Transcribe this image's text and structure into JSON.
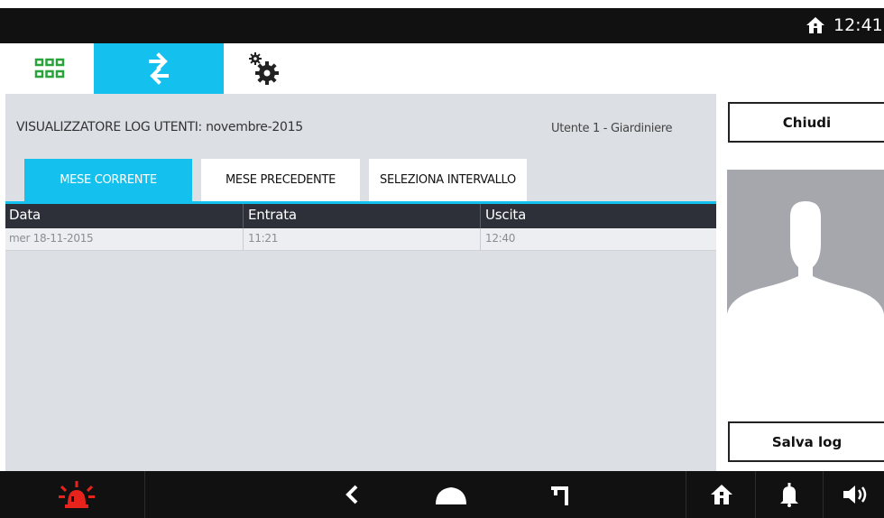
{
  "status": {
    "time": "12:41",
    "home_icon": "home-icon"
  },
  "app_tabs": [
    {
      "name": "apps-grid",
      "icon": "grid-icon",
      "color": "#2aa33b"
    },
    {
      "name": "transfer",
      "icon": "arrows-exchange-icon",
      "active": true
    },
    {
      "name": "settings",
      "icon": "gears-icon"
    }
  ],
  "header": {
    "title": "VISUALIZZATORE LOG UTENTI:  novembre-2015",
    "user": "Utente 1 - Giardiniere"
  },
  "period_tabs": [
    {
      "label": "MESE CORRENTE",
      "active": true
    },
    {
      "label": "MESE PRECEDENTE",
      "active": false
    },
    {
      "label": "SELEZIONA INTERVALLO",
      "active": false
    }
  ],
  "table": {
    "columns": [
      "Data",
      "Entrata",
      "Uscita"
    ],
    "rows": [
      [
        "mer 18-11-2015",
        "11:21",
        "12:40"
      ]
    ]
  },
  "side": {
    "close_label": "Chiudi",
    "save_label": "Salva log",
    "avatar_icon": "user-silhouette-icon"
  },
  "nav": {
    "alarm_icon": "alarm-siren-icon",
    "back_icon": "back-chevron-icon",
    "home_icon": "home-dome-icon",
    "recent_icon": "recent-apps-icon",
    "house_icon": "house-icon",
    "bell_icon": "bell-icon",
    "volume_icon": "volume-icon"
  },
  "colors": {
    "accent": "#14c1ee",
    "alarm": "#e8231c",
    "grid_icon": "#2aa33b",
    "content_bg": "#dcdfe4",
    "table_header": "#2d3038"
  }
}
